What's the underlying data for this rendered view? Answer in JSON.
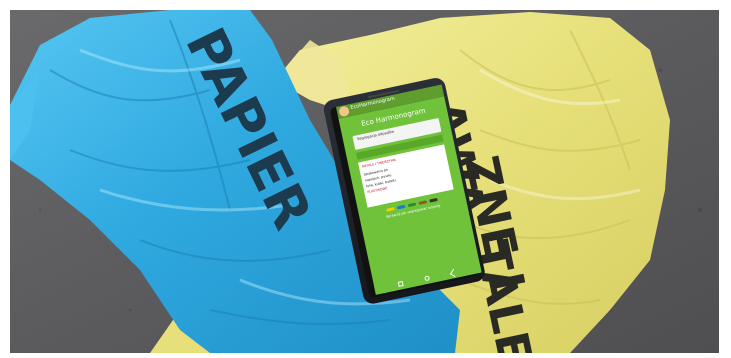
{
  "scene": {
    "description_tags": [
      "blue-plastic-bag-icon",
      "yellow-plastic-bag-icon",
      "smartphone-icon"
    ]
  },
  "bags": {
    "blue_print": "PAPIER",
    "yellow_print_line1": "AWA",
    "yellow_print_line2": "ZNE I",
    "yellow_print_line3": "TALE"
  },
  "phone": {
    "app_name": "EcoHarmonogram",
    "app_title": "Eco Harmonogram",
    "field_label": "Segregacja odpadów",
    "button_label": "",
    "result_lines": [
      "METALE I TWORZYWA",
      "Opakowania po",
      "napojach, puszki,",
      "folie, kubki, butelki",
      "PLASTIKOWE"
    ],
    "footer": "Sprawdź jak segregować odpady"
  },
  "colors": {
    "background_floor": "#5e5e60",
    "blue_bag": "#38b3e6",
    "yellow_bag": "#eae58a",
    "app_green": "#6fc23a"
  }
}
